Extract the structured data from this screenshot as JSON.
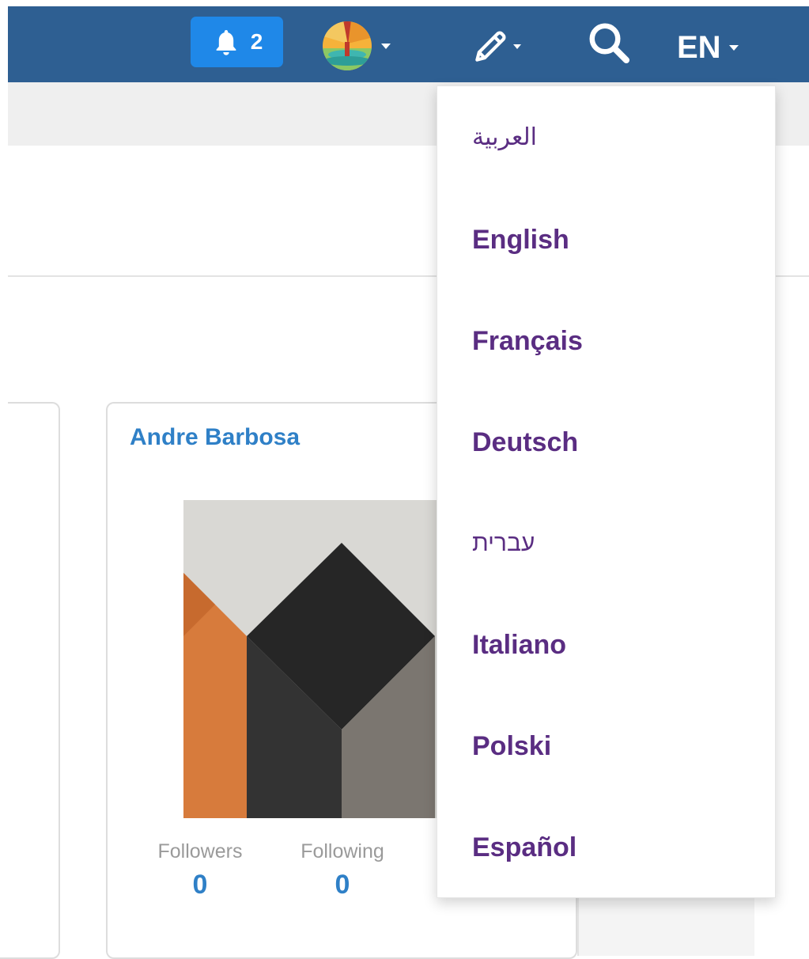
{
  "navbar": {
    "notification_count": "2",
    "language_code": "EN",
    "colors": {
      "bar": "#2e5f92",
      "notification_bg": "#1f88e8"
    },
    "icons": [
      "bell-icon",
      "avatar",
      "pencil-icon",
      "search-icon",
      "caret-down-icon"
    ]
  },
  "profile_card": {
    "name": "Andre Barbosa",
    "followers_label": "Followers",
    "followers_value": "0",
    "following_label": "Following",
    "following_value": "0"
  },
  "language_menu": {
    "items": [
      {
        "label": "العربية"
      },
      {
        "label": "English"
      },
      {
        "label": "Français"
      },
      {
        "label": "Deutsch"
      },
      {
        "label": "עברית"
      },
      {
        "label": "Italiano"
      },
      {
        "label": "Polski"
      },
      {
        "label": "Español"
      }
    ],
    "text_color": "#5a2d82"
  }
}
